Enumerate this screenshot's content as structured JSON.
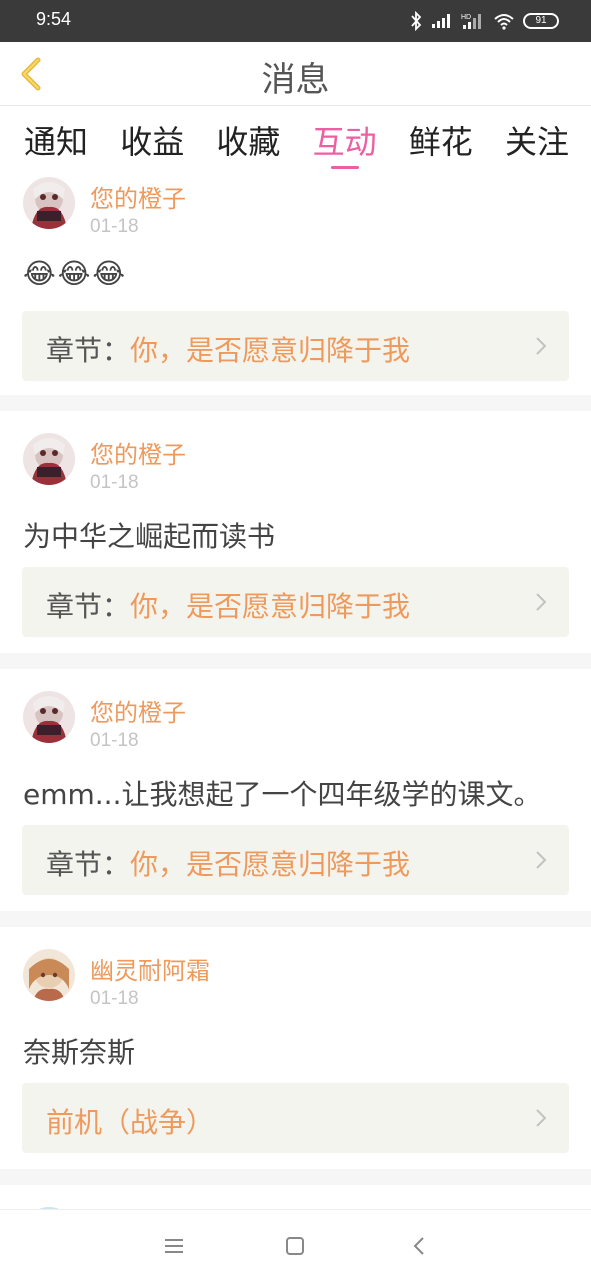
{
  "status_bar": {
    "time": "9:54",
    "battery": "91"
  },
  "header": {
    "title": "消息"
  },
  "tabs": [
    {
      "label": "通知",
      "active": false
    },
    {
      "label": "收益",
      "active": false
    },
    {
      "label": "收藏",
      "active": false
    },
    {
      "label": "互动",
      "active": true
    },
    {
      "label": "鲜花",
      "active": false
    },
    {
      "label": "关注",
      "active": false
    }
  ],
  "messages": [
    {
      "user": "您的橙子",
      "date": "01-18",
      "comment": "😂😂😂",
      "ref_prefix": "章节：",
      "ref_title": "你，是否愿意归降于我"
    },
    {
      "user": "您的橙子",
      "date": "01-18",
      "comment": "为中华之崛起而读书",
      "ref_prefix": "章节：",
      "ref_title": "你，是否愿意归降于我"
    },
    {
      "user": "您的橙子",
      "date": "01-18",
      "comment": "emm...让我想起了一个四年级学的课文。",
      "ref_prefix": "章节：",
      "ref_title": "你，是否愿意归降于我"
    },
    {
      "user": "幽灵耐阿霜",
      "date": "01-18",
      "comment": "奈斯奈斯",
      "ref_prefix": "",
      "ref_title": "前机（战争）"
    }
  ],
  "colors": {
    "accent": "#ec5fa0",
    "username": "#ee9a5d",
    "ref_bg": "#f4f4ee"
  }
}
